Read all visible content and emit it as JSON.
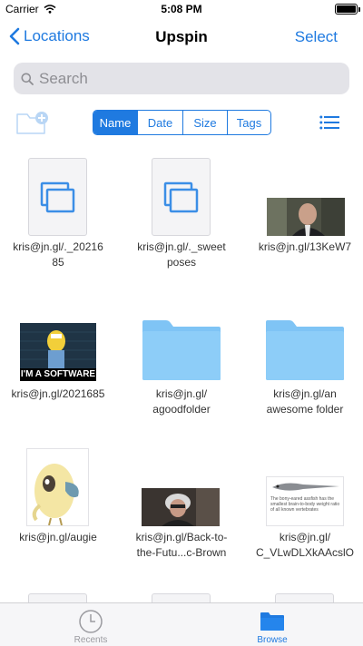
{
  "status_bar": {
    "carrier": "Carrier",
    "time": "5:08 PM"
  },
  "nav": {
    "back_label": "Locations",
    "title": "Upspin",
    "select_label": "Select"
  },
  "search": {
    "placeholder": "Search"
  },
  "sort": {
    "options": [
      "Name",
      "Date",
      "Size",
      "Tags"
    ],
    "selected": "Name"
  },
  "items": [
    {
      "label": "kris@jn.gl/._20216\n85",
      "kind": "document"
    },
    {
      "label": "kris@jn.gl/._sweet\nposes",
      "kind": "document"
    },
    {
      "label": "kris@jn.gl/13KeW7",
      "kind": "image"
    },
    {
      "label": "kris@jn.gl/2021685",
      "kind": "image",
      "caption": "I'M A SOFTWARE"
    },
    {
      "label": "kris@jn.gl/\nagoodfolder",
      "kind": "folder"
    },
    {
      "label": "kris@jn.gl/an\nawesome folder",
      "kind": "folder"
    },
    {
      "label": "kris@jn.gl/augie",
      "kind": "image"
    },
    {
      "label": "kris@jn.gl/Back-to-\nthe-Futu...c-Brown",
      "kind": "image"
    },
    {
      "label": "kris@jn.gl/\nC_VLwDLXkAAcslO",
      "kind": "image",
      "caption": "The bony-eared assfish has the smallest brain-to-body weight ratio of all known vertebrates"
    }
  ],
  "tab_bar": {
    "tabs": [
      {
        "label": "Recents",
        "active": false
      },
      {
        "label": "Browse",
        "active": true
      }
    ]
  },
  "colors": {
    "accent": "#1f7ae0",
    "folder": "#7fc4f5",
    "inactive": "#8e8e93"
  }
}
